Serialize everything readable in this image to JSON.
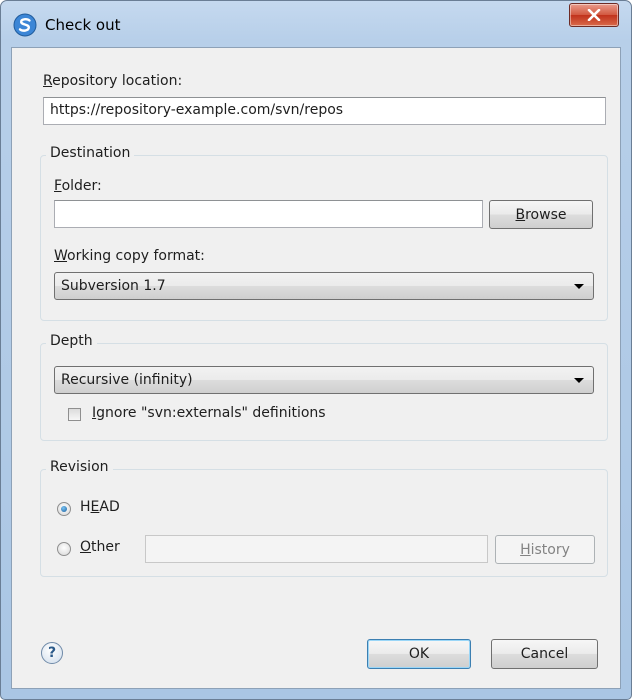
{
  "window": {
    "title": "Check out",
    "close_label": "X",
    "accent": "#c1321c"
  },
  "repository": {
    "label_mnemonic": "R",
    "label_rest": "epository location:",
    "value": "https://repository-example.com/svn/repos"
  },
  "destination": {
    "legend": "Destination",
    "folder_label_mnemonic": "F",
    "folder_label_rest": "older:",
    "folder_value": "",
    "browse_mnemonic": "B",
    "browse_rest": "rowse",
    "format_label_mnemonic": "W",
    "format_label_rest": "orking copy format:",
    "format_selected": "Subversion 1.7"
  },
  "depth": {
    "legend": "Depth",
    "selected": "Recursive (infinity)",
    "ignore_mnemonic": "I",
    "ignore_rest": "gnore \"svn:externals\" definitions",
    "ignore_checked": false
  },
  "revision": {
    "legend": "Revision",
    "head_pre": "H",
    "head_mnemonic": "E",
    "head_post": "AD",
    "head_checked": true,
    "other_mnemonic": "O",
    "other_rest": "ther",
    "other_checked": false,
    "other_value": "",
    "history_mnemonic": "H",
    "history_rest": "istory"
  },
  "footer": {
    "help_icon": "?",
    "ok_label": "OK",
    "cancel_label": "Cancel"
  }
}
